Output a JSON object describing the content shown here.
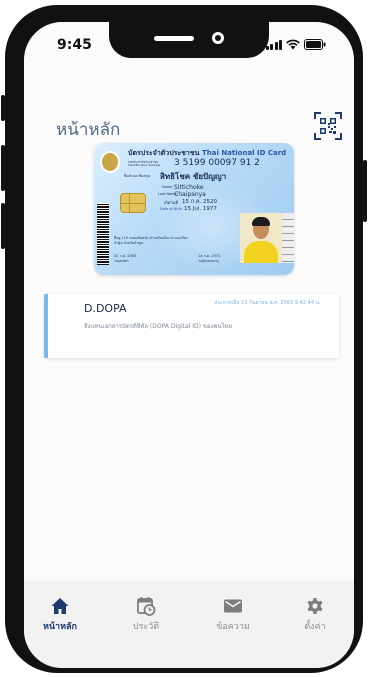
{
  "status": {
    "time": "9:45"
  },
  "header": {
    "title": "หน้าหลัก",
    "qr_icon": "qr-code-icon"
  },
  "id_card": {
    "title_th": "บัตรประจำตัวประชาชน",
    "title_en": "Thai National ID Card",
    "id_label": "เลขประจำตัวประชาชน Identification Number",
    "id_number": "3 5199 00097 91 2",
    "name_th_label": "ชื่อตัวและชื่อสกุล",
    "name_th": "สิทธิโชค ชัยปัญญา",
    "name_en_label": "Name",
    "name_en": "Sittichoke",
    "lastname_en_label": "Last Name",
    "lastname_en": "Chaipanya",
    "dob_th_label": "เกิดวันที่",
    "dob_th": "15 ก.ค. 2520",
    "dob_en_label": "Date of Birth",
    "dob_en": "15 Jul. 1977",
    "address": "ที่อยู่ 115 ถนนเดิมหลัง ตำบลริมเมือง อำเภอเมือง",
    "address2": "จำพูน จังหวัดลำพูน",
    "issue_date": "02 ก.ค. 2563",
    "issue_label": "วันออกบัตร",
    "expiry_date": "14 ก.ค. 2571",
    "expiry_label": "วันบัตรหมดอายุ"
  },
  "notification": {
    "title": "D.DOPA",
    "time": "ประกาศเมื่อ 15 กันยายน พ.ศ. 2563  9:42:44 น.",
    "description": "สิ่งแทนเอกสารบัตรดิจิทัล (DOPA Digital ID) ของคนไทย"
  },
  "nav": {
    "items": [
      {
        "label": "หน้าหลัก",
        "icon": "home-icon",
        "active": true
      },
      {
        "label": "ประวัติ",
        "icon": "calendar-history-icon",
        "active": false
      },
      {
        "label": "ข้อความ",
        "icon": "mail-icon",
        "active": false
      },
      {
        "label": "ตั้งค่า",
        "icon": "gear-icon",
        "active": false
      }
    ]
  },
  "colors": {
    "accent": "#1c3a6e",
    "title": "#4e6b88",
    "notification_border": "#7ab9e6",
    "nav_background": "#f2f2f3"
  }
}
